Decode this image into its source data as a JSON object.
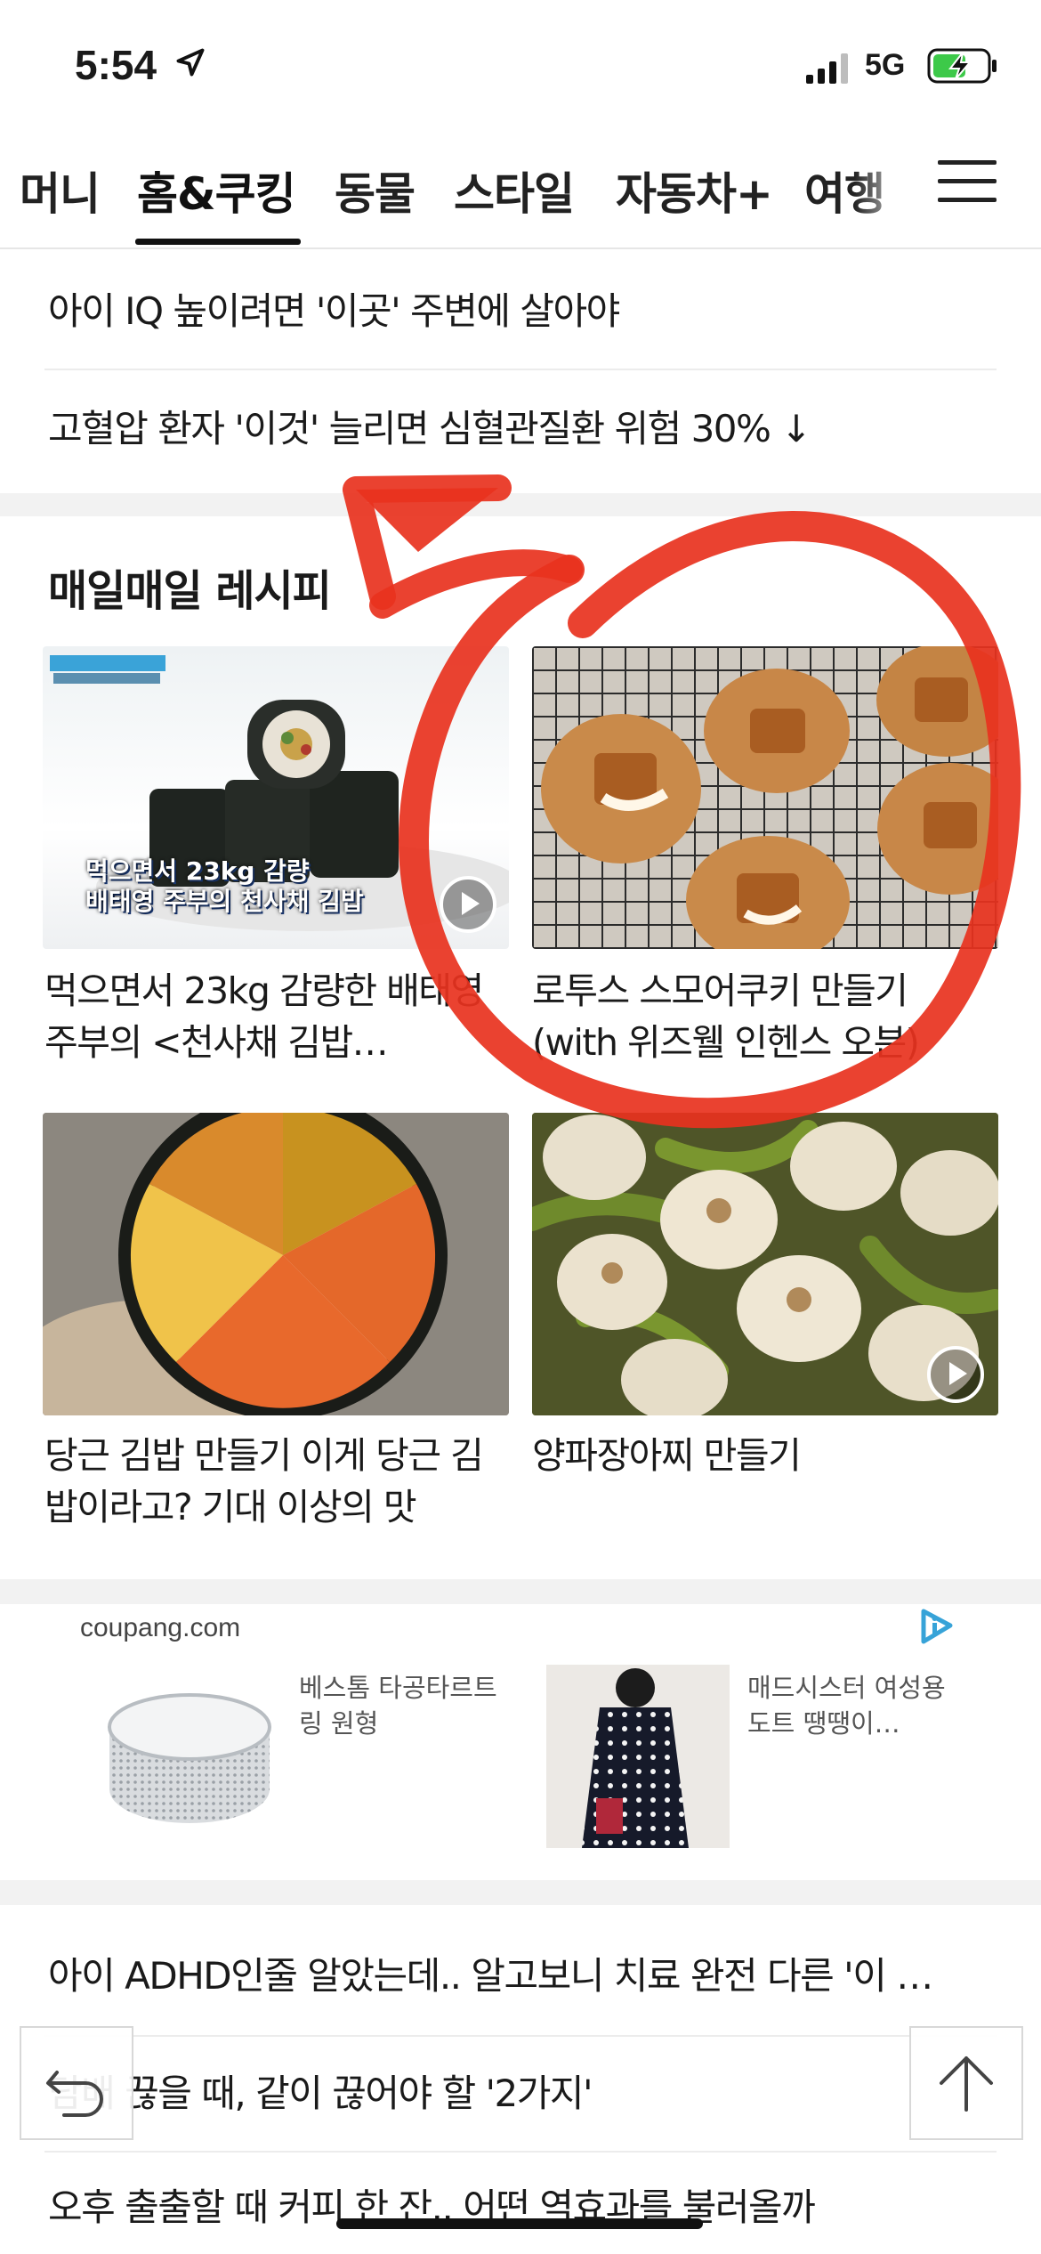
{
  "status_bar": {
    "time": "5:54",
    "network": "5G"
  },
  "tabs": [
    {
      "label": "머니"
    },
    {
      "label": "홈&쿠킹",
      "active": true
    },
    {
      "label": "동물"
    },
    {
      "label": "스타일"
    },
    {
      "label": "자동차+"
    },
    {
      "label": "여행"
    }
  ],
  "headlines_top": [
    "아이 IQ 높이려면 '이곳' 주변에 살아야",
    "고혈압 환자 '이것' 늘리면 심혈관질환 위험 30% ↓"
  ],
  "recipes": {
    "title": "매일매일 레시피",
    "items": [
      {
        "caption": "먹으면서 23kg 감량한 배태영 주부의 <천사채 김밥…",
        "image_caption": "먹으면서 23kg 감량\n배태영 주부의 천사채 김밥",
        "video": true
      },
      {
        "caption": "로투스 스모어쿠키 만들기 (with 위즈웰 인헨스 오븐)",
        "video": false
      },
      {
        "caption": "당근 김밥 만들기 이게 당근 김밥이라고? 기대 이상의 맛",
        "video": false
      },
      {
        "caption": "양파장아찌 만들기",
        "video": true
      }
    ]
  },
  "ad": {
    "source": "coupang.com",
    "items": [
      {
        "text": "베스톰 타공타르트링 원형"
      },
      {
        "text": "매드시스터 여성용 도트 땡땡이…"
      }
    ]
  },
  "headlines_bottom": [
    "아이 ADHD인줄 알았는데.. 알고보니 치료 완전 다른 '이 …",
    "담배 끊을 때, 같이 끊어야 할 '2가지'",
    "오후 출출할 때 커피 한 잔.. 어떤 역효과를 불러올까"
  ],
  "colors": {
    "annotation": "#e8321e",
    "text": "#1a1a1a",
    "band": "#f2f2f2"
  }
}
